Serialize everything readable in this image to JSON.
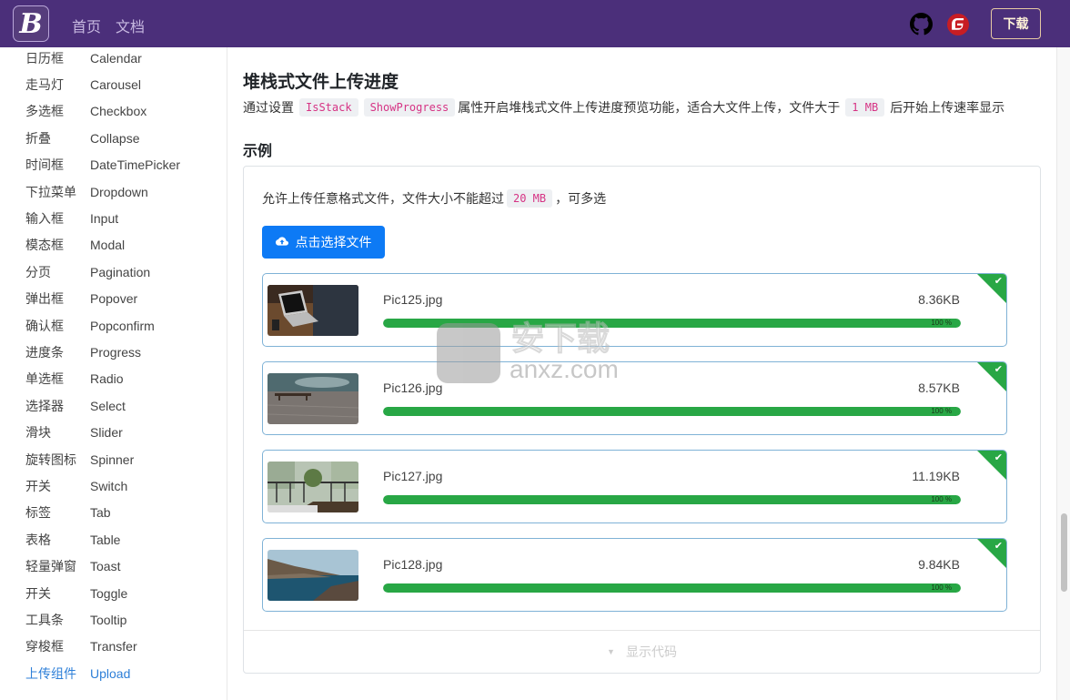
{
  "header": {
    "logo_letter": "B",
    "nav": [
      {
        "label": "首页"
      },
      {
        "label": "文档"
      }
    ],
    "icons": [
      "github-icon",
      "gitee-icon"
    ],
    "download_label": "下载",
    "colors": {
      "background": "#4b2f7a",
      "nav_text": "#c7b8e0"
    }
  },
  "sidebar": {
    "items": [
      {
        "zh": "日历框",
        "en": "Calendar"
      },
      {
        "zh": "走马灯",
        "en": "Carousel"
      },
      {
        "zh": "多选框",
        "en": "Checkbox"
      },
      {
        "zh": "折叠",
        "en": "Collapse"
      },
      {
        "zh": "时间框",
        "en": "DateTimePicker"
      },
      {
        "zh": "下拉菜单",
        "en": "Dropdown"
      },
      {
        "zh": "输入框",
        "en": "Input"
      },
      {
        "zh": "模态框",
        "en": "Modal"
      },
      {
        "zh": "分页",
        "en": "Pagination"
      },
      {
        "zh": "弹出框",
        "en": "Popover"
      },
      {
        "zh": "确认框",
        "en": "Popconfirm"
      },
      {
        "zh": "进度条",
        "en": "Progress"
      },
      {
        "zh": "单选框",
        "en": "Radio"
      },
      {
        "zh": "选择器",
        "en": "Select"
      },
      {
        "zh": "滑块",
        "en": "Slider"
      },
      {
        "zh": "旋转图标",
        "en": "Spinner"
      },
      {
        "zh": "开关",
        "en": "Switch"
      },
      {
        "zh": "标签",
        "en": "Tab"
      },
      {
        "zh": "表格",
        "en": "Table"
      },
      {
        "zh": "轻量弹窗",
        "en": "Toast"
      },
      {
        "zh": "开关",
        "en": "Toggle"
      },
      {
        "zh": "工具条",
        "en": "Tooltip"
      },
      {
        "zh": "穿梭框",
        "en": "Transfer"
      },
      {
        "zh": "上传组件",
        "en": "Upload",
        "active": true
      }
    ],
    "active_color": "#2d7fd8"
  },
  "main": {
    "title": "堆栈式文件上传进度",
    "description": {
      "prefix": "通过设置",
      "code1": "IsStack",
      "code2": "ShowProgress",
      "middle": "属性开启堆栈式文件上传进度预览功能，适合大文件上传，文件大于",
      "code3": "1 MB",
      "suffix": "后开始上传速率显示"
    },
    "example_label": "示例",
    "example": {
      "allow_prefix": "允许上传任意格式文件，文件大小不能超过",
      "allow_code": "20 MB",
      "allow_suffix": "，可多选",
      "upload_button": "点击选择文件",
      "files": [
        {
          "name": "Pic125.jpg",
          "size": "8.36KB",
          "progress": 100,
          "progress_label": "100 %",
          "status": "success",
          "thumb": "laptop"
        },
        {
          "name": "Pic126.jpg",
          "size": "8.57KB",
          "progress": 100,
          "progress_label": "100 %",
          "status": "success",
          "thumb": "pier"
        },
        {
          "name": "Pic127.jpg",
          "size": "11.19KB",
          "progress": 100,
          "progress_label": "100 %",
          "status": "success",
          "thumb": "balcony"
        },
        {
          "name": "Pic128.jpg",
          "size": "9.84KB",
          "progress": 100,
          "progress_label": "100 %",
          "status": "success",
          "thumb": "coast"
        }
      ],
      "show_code_label": "显示代码"
    },
    "colors": {
      "primary": "#0d7af5",
      "success": "#28a745",
      "code_text": "#d63384",
      "card_border": "#7fb2d6"
    }
  },
  "watermark": {
    "zh": "安下载",
    "en": "anxz.com"
  }
}
